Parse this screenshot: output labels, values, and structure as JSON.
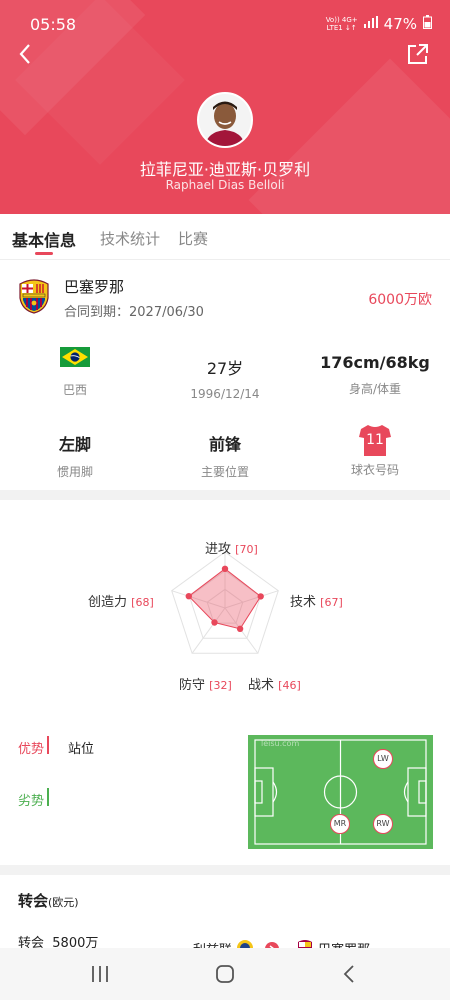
{
  "status": {
    "time": "05:58",
    "net_top": "Vo)) 4G+",
    "net_bottom": "LTE1 ↓↑",
    "battery": "47%"
  },
  "header": {
    "name_cn": "拉菲尼亚·迪亚斯·贝罗利",
    "name_en": "Raphael Dias Belloli",
    "accent": "#e8485b"
  },
  "tabs": [
    {
      "label": "基本信息"
    },
    {
      "label": "技术统计"
    },
    {
      "label": "比赛"
    }
  ],
  "club": {
    "name": "巴塞罗那",
    "contract": "合同到期：2027/06/30",
    "value": "6000万欧"
  },
  "info": {
    "nation": "巴西",
    "age": "27岁",
    "birth": "1996/12/14",
    "height_weight": "176cm/68kg",
    "height_weight_label": "身高/体重",
    "foot": "左脚",
    "foot_label": "惯用脚",
    "position": "前锋",
    "position_label": "主要位置",
    "number": "11",
    "number_label": "球衣号码"
  },
  "radar": {
    "attack_label": "进攻",
    "attack": 70,
    "technique_label": "技术",
    "technique": 67,
    "tactics_label": "战术",
    "tactics": 46,
    "defense_label": "防守",
    "defense": 32,
    "creativity_label": "创造力",
    "creativity": 68
  },
  "strengths": {
    "advantage_label": "优势",
    "advantage_item": "站位",
    "weakness_label": "劣势"
  },
  "pitch": {
    "watermark": "leisu.com",
    "positions": [
      "LW",
      "MR",
      "RW"
    ]
  },
  "transfer": {
    "title": "转会",
    "unit": "(欧元)",
    "row_label": "转会",
    "row_value": "5800万",
    "from": "利兹联",
    "to": "巴塞罗那"
  }
}
